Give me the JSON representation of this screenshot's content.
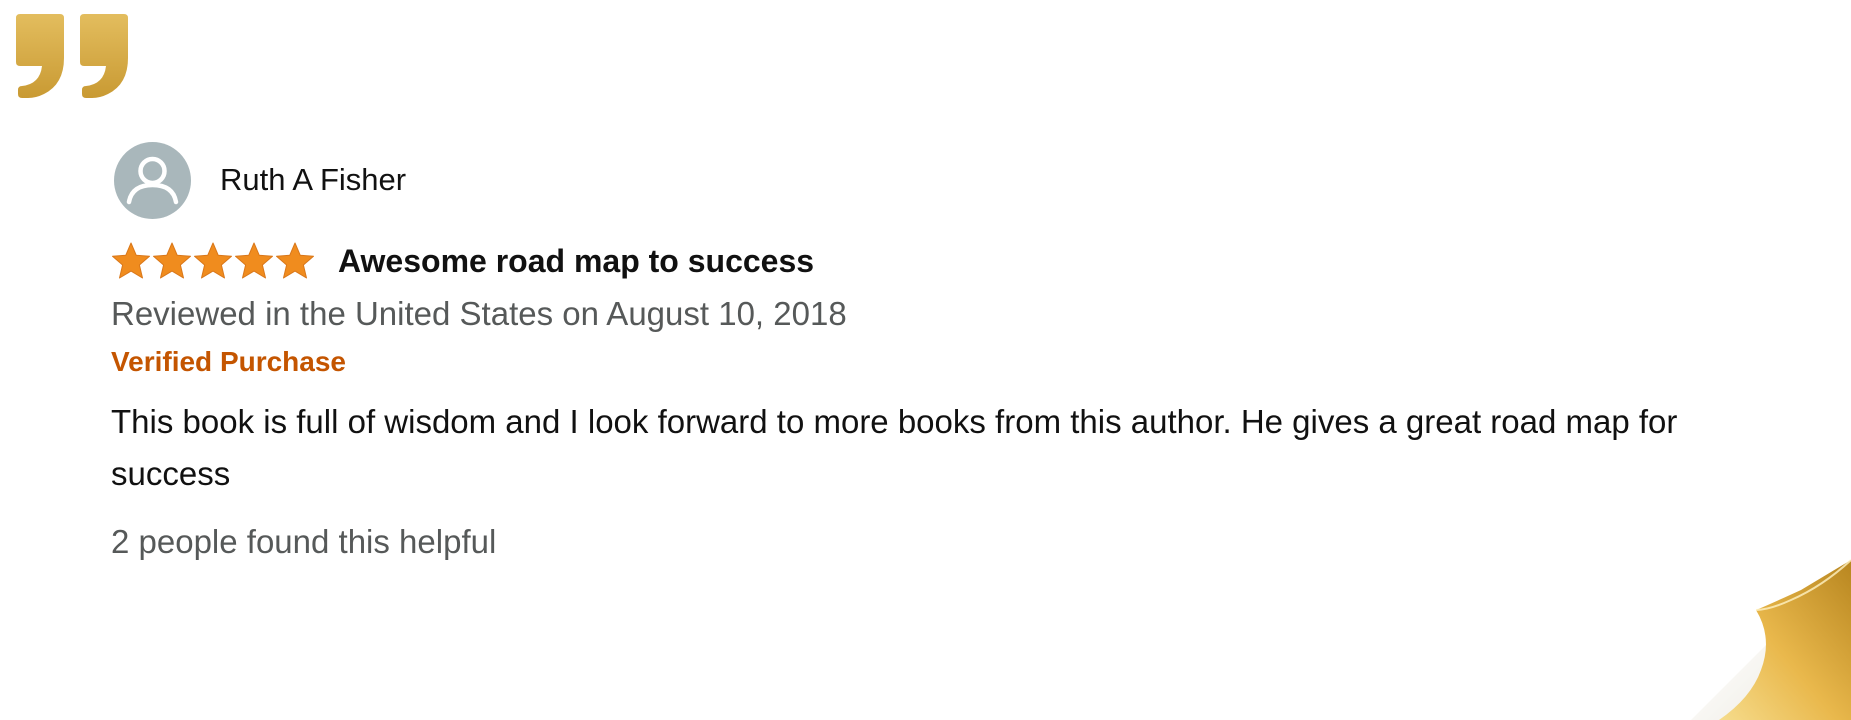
{
  "review": {
    "reviewer_name": "Ruth A Fisher",
    "rating": 5,
    "rating_max": 5,
    "title": "Awesome road map to success",
    "date_line": "Reviewed in the United States on August 10, 2018",
    "verified_label": "Verified Purchase",
    "body": "This book is full of wisdom and I look forward to more books from this author. He gives a great road map for success",
    "helpful_text": "2 people found this helpful"
  },
  "icons": {
    "quote": "closing-quote-icon",
    "avatar": "user-avatar-icon",
    "star": "star-icon",
    "page_curl": "page-curl-decoration"
  },
  "colors": {
    "gold": "#d4a640",
    "star": "#f08c1e",
    "verified": "#c45500",
    "secondary_text": "#565959",
    "avatar_bg": "#a9b7bb"
  }
}
